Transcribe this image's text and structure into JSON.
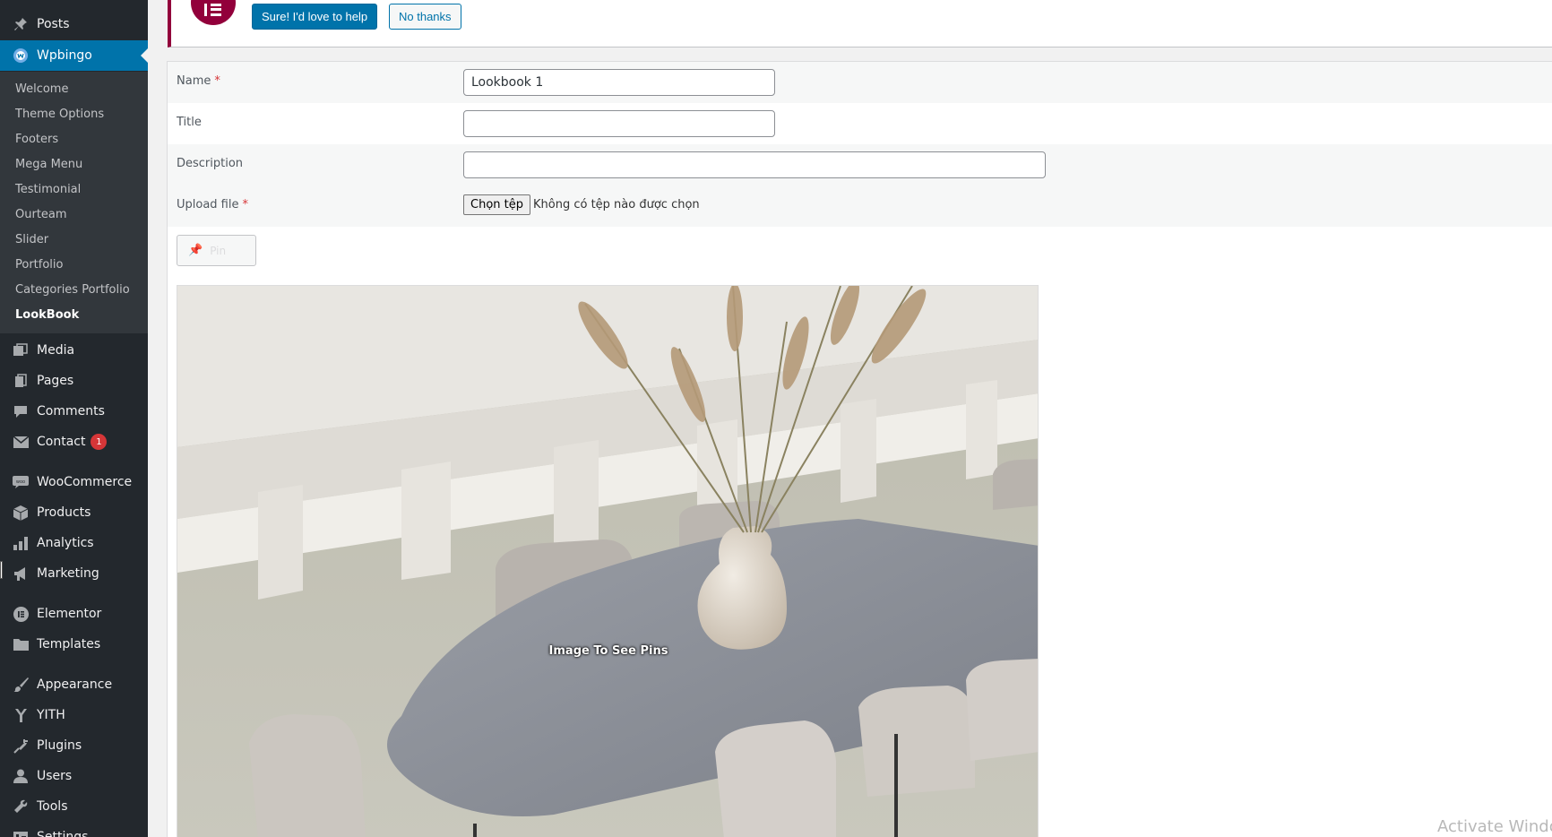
{
  "sidebar": {
    "top_items": [
      {
        "label": "Posts",
        "icon": "pushpin-icon"
      },
      {
        "label": "Wpbingo",
        "icon": "wpbingo-logo-icon"
      }
    ],
    "wpbingo_submenu": [
      "Welcome",
      "Theme Options",
      "Footers",
      "Mega Menu",
      "Testimonial",
      "Ourteam",
      "Slider",
      "Portfolio",
      "Categories Portfolio",
      "LookBook"
    ],
    "active_submenu": "LookBook",
    "items": [
      {
        "label": "Media",
        "icon": "media-icon"
      },
      {
        "label": "Pages",
        "icon": "pages-icon"
      },
      {
        "label": "Comments",
        "icon": "comment-icon"
      },
      {
        "label": "Contact",
        "icon": "envelope-icon",
        "badge": "1"
      },
      {
        "label": "WooCommerce",
        "icon": "woocommerce-icon"
      },
      {
        "label": "Products",
        "icon": "box-icon"
      },
      {
        "label": "Analytics",
        "icon": "bar-chart-icon"
      },
      {
        "label": "Marketing",
        "icon": "megaphone-icon"
      },
      {
        "label": "Elementor",
        "icon": "elementor-icon"
      },
      {
        "label": "Templates",
        "icon": "folder-icon"
      },
      {
        "label": "Appearance",
        "icon": "paintbrush-icon"
      },
      {
        "label": "YITH",
        "icon": "yith-icon"
      },
      {
        "label": "Plugins",
        "icon": "plug-icon"
      },
      {
        "label": "Users",
        "icon": "user-icon"
      },
      {
        "label": "Tools",
        "icon": "wrench-icon"
      },
      {
        "label": "Settings",
        "icon": "settings-icon"
      }
    ],
    "colors": {
      "background": "#23282d",
      "submenu": "#32373c",
      "current": "#0073aa"
    }
  },
  "notice": {
    "accept_label": "Sure! I'd love to help",
    "decline_label": "No thanks",
    "logo_icon": "elementor-logo-icon",
    "accent": "#92003b"
  },
  "form": {
    "name": {
      "label": "Name",
      "required": "*",
      "value": "Lookbook 1"
    },
    "title": {
      "label": "Title",
      "value": ""
    },
    "description": {
      "label": "Description",
      "value": ""
    },
    "upload": {
      "label": "Upload file",
      "required": "*",
      "button": "Chọn tệp",
      "status": "Không có tệp nào được chọn"
    },
    "pin_button": {
      "label": "Pin",
      "icon": "pushpin-icon"
    }
  },
  "image": {
    "caption": "Image To See Pins"
  },
  "watermark": "Activate Windo"
}
